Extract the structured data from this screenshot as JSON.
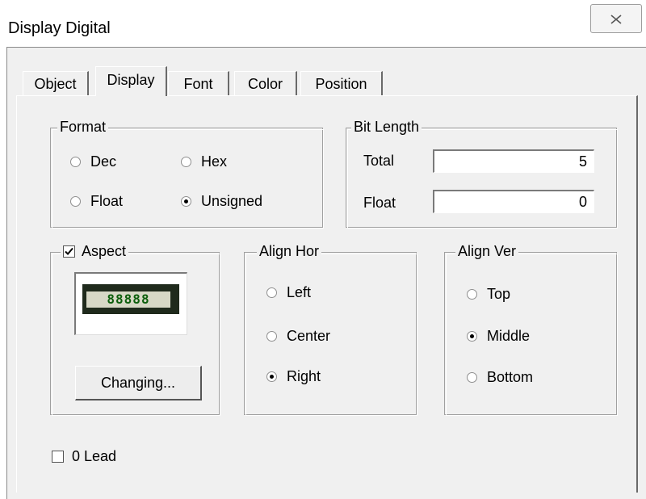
{
  "window": {
    "title": "Display Digital"
  },
  "tabs": [
    {
      "label": "Object",
      "active": false
    },
    {
      "label": "Display",
      "active": true
    },
    {
      "label": "Font",
      "active": false
    },
    {
      "label": "Color",
      "active": false
    },
    {
      "label": "Position",
      "active": false
    }
  ],
  "format": {
    "legend": "Format",
    "options": [
      {
        "label": "Dec",
        "checked": false
      },
      {
        "label": "Hex",
        "checked": false
      },
      {
        "label": "Float",
        "checked": false
      },
      {
        "label": "Unsigned",
        "checked": true
      }
    ]
  },
  "bit_length": {
    "legend": "Bit Length",
    "total_label": "Total",
    "total_value": "5",
    "float_label": "Float",
    "float_value": "0"
  },
  "aspect": {
    "legend": "Aspect",
    "checked": true,
    "preview_text": "88888",
    "button_label": "Changing..."
  },
  "align_hor": {
    "legend": "Align Hor",
    "options": [
      {
        "label": "Left",
        "checked": false
      },
      {
        "label": "Center",
        "checked": false
      },
      {
        "label": "Right",
        "checked": true
      }
    ]
  },
  "align_ver": {
    "legend": "Align Ver",
    "options": [
      {
        "label": "Top",
        "checked": false
      },
      {
        "label": "Middle",
        "checked": true
      },
      {
        "label": "Bottom",
        "checked": false
      }
    ]
  },
  "zero_lead": {
    "label": "0 Lead",
    "checked": false
  },
  "icons": {
    "close": "close-icon",
    "check": "check-icon"
  }
}
